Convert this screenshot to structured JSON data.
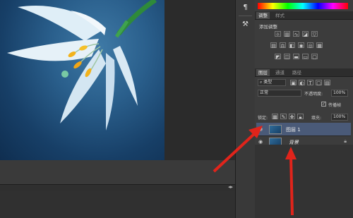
{
  "tool_column": {
    "icons": [
      "paragraph-icon",
      "tool-icon"
    ]
  },
  "panels": {
    "color_tabs": [
      "调整",
      "样式"
    ],
    "adjustments_title": "添加调整",
    "layers_tabs": [
      "图层",
      "通道",
      "路径"
    ],
    "filter_type": "类型",
    "blend_mode": "正常",
    "opacity_label": "不透明度:",
    "opacity_value": "100%",
    "propagate_label": "传播帧",
    "lock_label": "锁定:",
    "fill_label": "填充:",
    "fill_value": "100%",
    "layers": [
      {
        "name": "图层 1",
        "selected": true
      },
      {
        "name": "背景",
        "selected": false
      }
    ]
  },
  "colors": {
    "annotation_arrow": "#e0241b",
    "panel_bg": "#3c3c3c",
    "selected_layer": "#4a5a78"
  }
}
